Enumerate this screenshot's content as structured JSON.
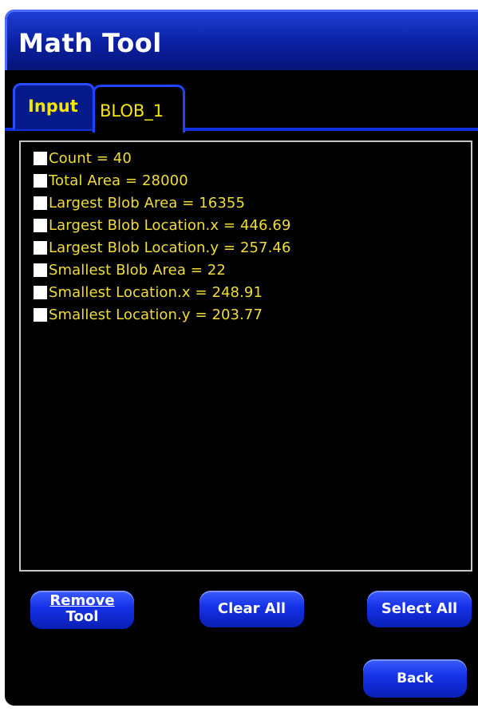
{
  "window": {
    "title": "Math Tool"
  },
  "tabs": [
    {
      "label": "Input",
      "active": false
    },
    {
      "label": "BLOB_1",
      "active": true
    }
  ],
  "results": [
    {
      "label": "Count = 40",
      "checked": false
    },
    {
      "label": "Total Area = 28000",
      "checked": false
    },
    {
      "label": "Largest Blob Area = 16355",
      "checked": false
    },
    {
      "label": "Largest Blob Location.x = 446.69",
      "checked": false
    },
    {
      "label": "Largest Blob Location.y = 257.46",
      "checked": false
    },
    {
      "label": "Smallest Blob Area = 22",
      "checked": false
    },
    {
      "label": "Smallest Location.x = 248.91",
      "checked": false
    },
    {
      "label": "Smallest Location.y = 203.77",
      "checked": false
    }
  ],
  "buttons": {
    "remove_tool_first": "Remove",
    "remove_tool_second": "Tool",
    "clear_all": "Clear All",
    "select_all": "Select All",
    "back": "Back"
  },
  "colors": {
    "background": "#000000",
    "titlebar": "#0a1fa0",
    "accent_blue": "#1e44ff",
    "text_yellow": "#f0dd3a",
    "button": "#1431e6"
  }
}
